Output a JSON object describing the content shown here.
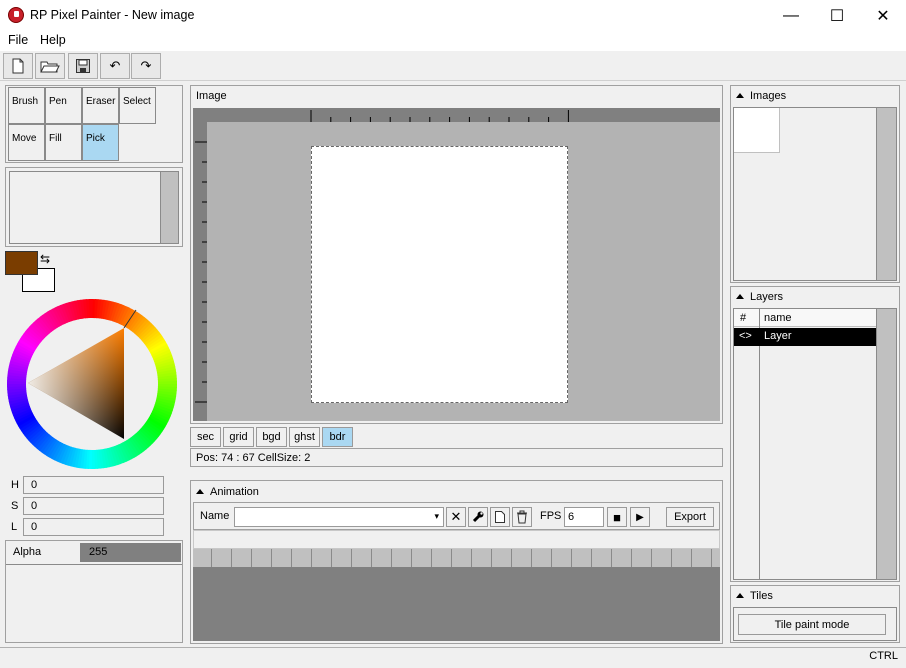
{
  "window": {
    "title": "RP Pixel Painter - New image",
    "app_icon": "app-logo-icon",
    "controls": [
      "minimize-icon",
      "maximize-icon",
      "close-icon"
    ],
    "minimize_glyph": "—",
    "maximize_glyph": "☐",
    "close_glyph": "✕"
  },
  "menu": {
    "items": [
      {
        "label": "File"
      },
      {
        "label": "Help"
      }
    ]
  },
  "toolbar": {
    "buttons": [
      {
        "name": "new-file-icon"
      },
      {
        "name": "open-folder-icon"
      },
      {
        "name": "save-icon"
      },
      {
        "name": "undo-icon",
        "glyph": "↶"
      },
      {
        "name": "redo-icon",
        "glyph": "↷"
      }
    ]
  },
  "tools": {
    "items": [
      {
        "label": "Brush",
        "selected": false
      },
      {
        "label": "Pen",
        "selected": false
      },
      {
        "label": "Eraser",
        "selected": false
      },
      {
        "label": "Select",
        "selected": false
      },
      {
        "label": "Move",
        "selected": false
      },
      {
        "label": "Fill",
        "selected": false
      },
      {
        "label": "Pick",
        "selected": true
      }
    ]
  },
  "colors": {
    "primary": "#7a3d00",
    "secondary": "#ffffff",
    "swap_glyph": "⇆",
    "selection_accent": "#aad8f2"
  },
  "hsl": {
    "h_label": "H",
    "h_value": "0",
    "s_label": "S",
    "s_value": "0",
    "l_label": "L",
    "l_value": "0"
  },
  "alpha": {
    "label": "Alpha",
    "value": "255"
  },
  "image_panel": {
    "title": "Image",
    "toggles": [
      {
        "label": "sec",
        "active": false
      },
      {
        "label": "grid",
        "active": false
      },
      {
        "label": "bgd",
        "active": false
      },
      {
        "label": "ghst",
        "active": false
      },
      {
        "label": "bdr",
        "active": true
      }
    ],
    "status": "Pos: 74 : 67 CellSize: 2"
  },
  "animation": {
    "title": "Animation",
    "name_label": "Name",
    "name_value": "",
    "fps_label": "FPS",
    "fps_value": "6",
    "export_label": "Export",
    "clear_glyph": "✕",
    "stop_glyph": "■",
    "play_glyph": "▶",
    "frame_count": 26
  },
  "images_panel": {
    "title": "Images"
  },
  "layers_panel": {
    "title": "Layers",
    "columns": [
      "#",
      "name"
    ],
    "rows": [
      {
        "visibility": "<>",
        "name": "Layer",
        "selected": true
      }
    ]
  },
  "tiles_panel": {
    "title": "Tiles",
    "button_label": "Tile paint mode"
  },
  "statusbar": {
    "right": "CTRL"
  }
}
